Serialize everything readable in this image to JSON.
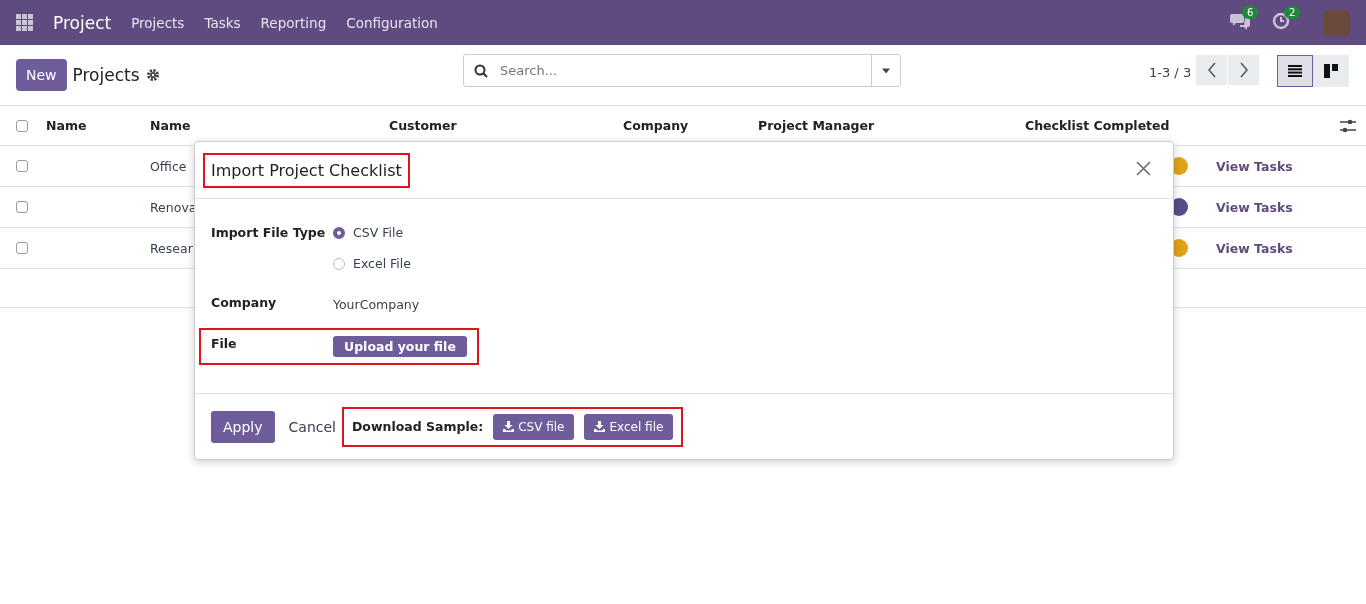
{
  "navbar": {
    "app": "Project",
    "menu": [
      "Projects",
      "Tasks",
      "Reporting",
      "Configuration"
    ],
    "messages_badge": "6",
    "activities_badge": "2"
  },
  "control_panel": {
    "new_button": "New",
    "title": "Projects",
    "search": {
      "placeholder": "Search..."
    },
    "pager": "1-3 / 3",
    "views": [
      {
        "kind": "list",
        "selected": true
      },
      {
        "kind": "kanban",
        "selected": false
      }
    ]
  },
  "table": {
    "select_all_checked": false,
    "columns": [
      "Name",
      "Name",
      "Customer",
      "Company",
      "Project Manager",
      "Checklist Completed"
    ],
    "rows": [
      {
        "checked": false,
        "name": "Office",
        "color": "#e0a21b",
        "link": "View Tasks"
      },
      {
        "checked": false,
        "name": "Renova",
        "color": "#5b4b8a",
        "link": "View Tasks"
      },
      {
        "checked": false,
        "name": "Resear",
        "color": "#e0a21b",
        "link": "View Tasks"
      }
    ]
  },
  "dialog": {
    "title": "Import Project Checklist",
    "highlighted_title": true,
    "fields": [
      {
        "kind": "radio",
        "label": "Import File Type",
        "options": [
          {
            "label": "CSV File",
            "selected": true
          },
          {
            "label": "Excel File",
            "selected": false
          }
        ]
      },
      {
        "kind": "text",
        "label": "Company",
        "value": "YourCompany"
      },
      {
        "kind": "upload",
        "label": "File",
        "button": "Upload your file",
        "highlighted": true
      }
    ],
    "footer": {
      "apply": "Apply",
      "cancel": "Cancel",
      "download_label": "Download Sample:",
      "downloads": [
        "CSV file",
        "Excel file"
      ],
      "highlighted": true
    }
  }
}
